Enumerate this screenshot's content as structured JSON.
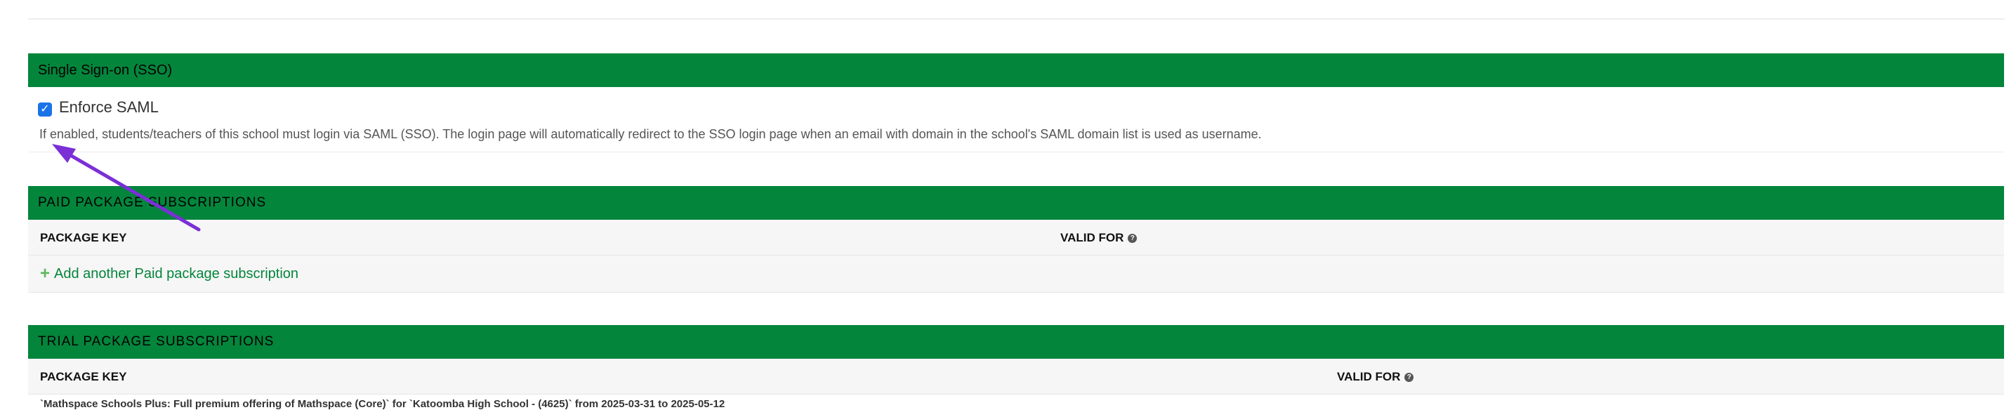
{
  "sso": {
    "header": "Single Sign-on (SSO)",
    "enforce_saml_label": "Enforce SAML",
    "enforce_saml_checked": true,
    "help_text": "If enabled, students/teachers of this school must login via SAML (SSO). The login page will automatically redirect to the SSO login page when an email with domain in the school's SAML domain list is used as username."
  },
  "paid": {
    "header": "PAID PACKAGE SUBSCRIPTIONS",
    "col_package_key": "PACKAGE KEY",
    "col_valid_for": "VALID FOR",
    "add_link": "Add another Paid package subscription"
  },
  "trial": {
    "header": "TRIAL PACKAGE SUBSCRIPTIONS",
    "col_package_key": "PACKAGE KEY",
    "col_valid_for": "VALID FOR",
    "first_row_text": "`Mathspace Schools Plus: Full premium offering of Mathspace (Core)` for `Katoomba High School - (4625)` from 2025-03-31 to 2025-05-12"
  },
  "annotation": {
    "arrow_color": "#7b2fd6"
  },
  "colors": {
    "header_green": "#04853c",
    "link_green": "#04853c"
  }
}
